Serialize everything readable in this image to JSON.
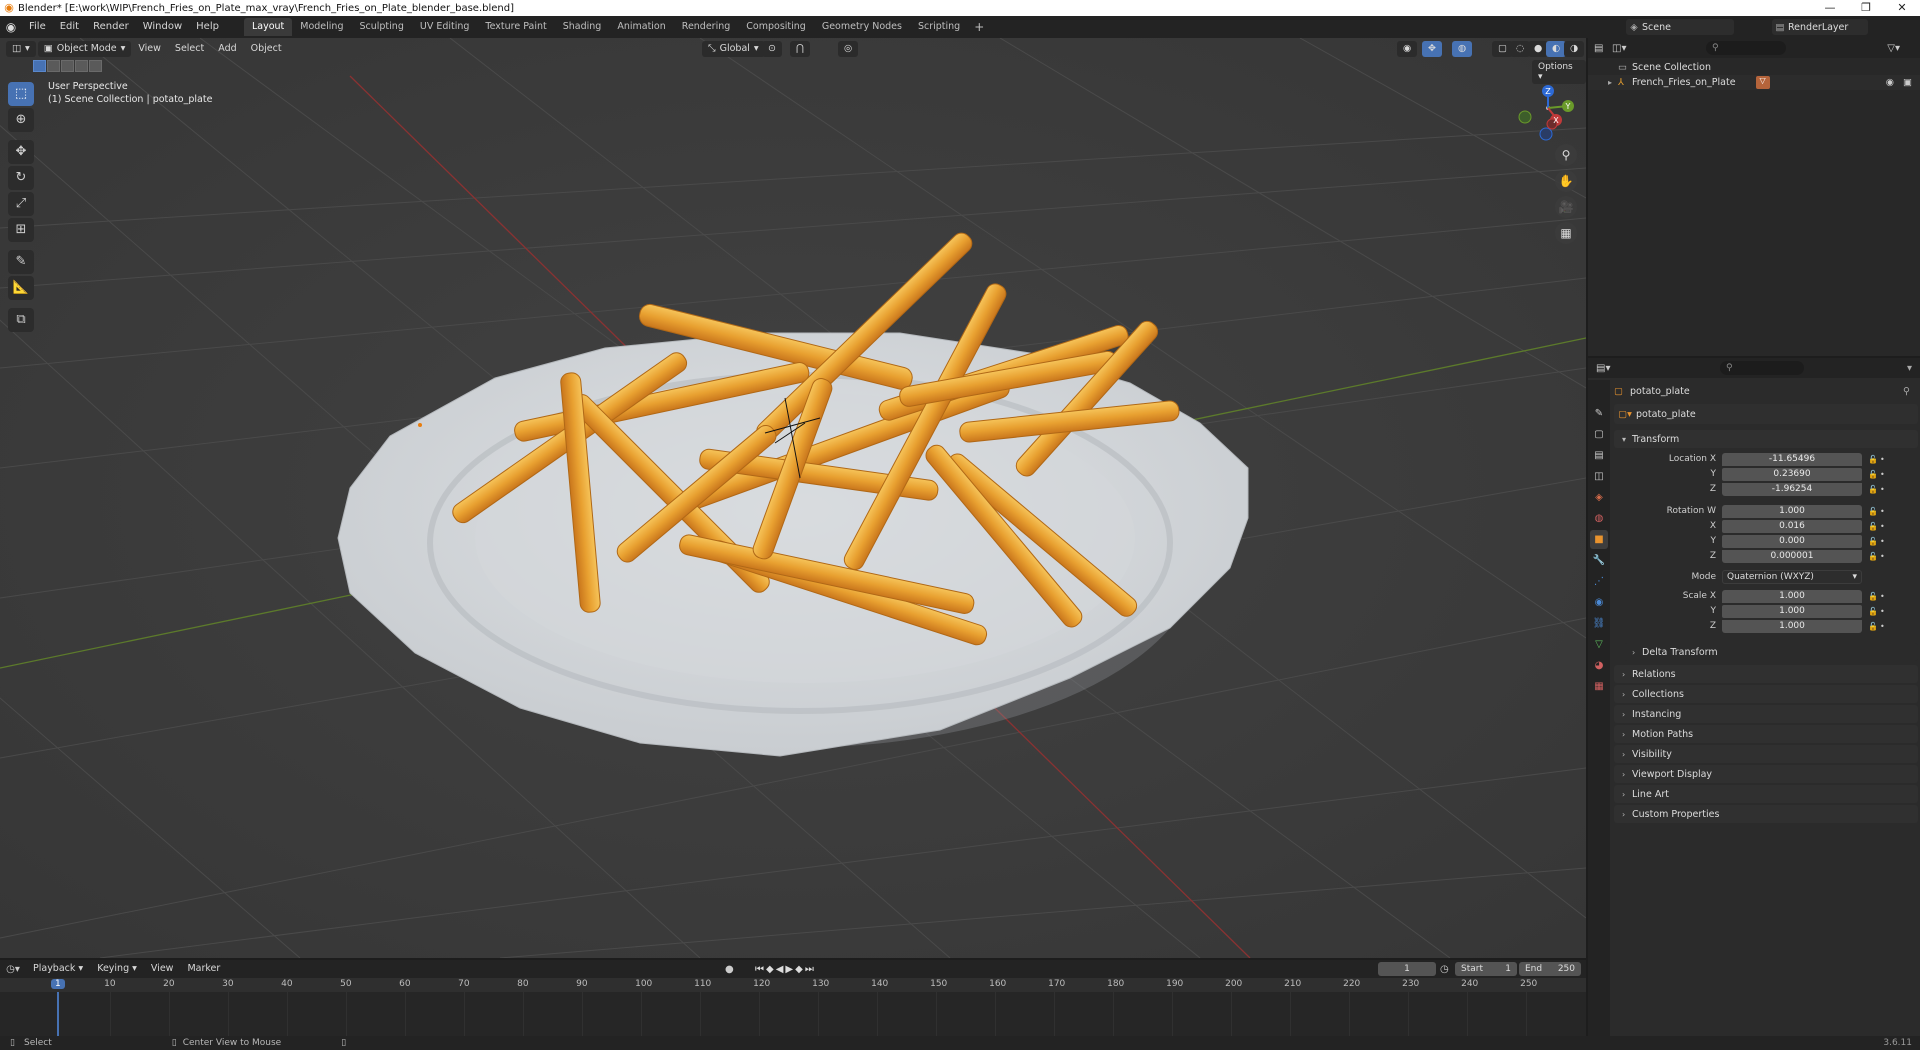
{
  "window": {
    "title": "Blender* [E:\\work\\WIP\\French_Fries_on_Plate_max_vray\\French_Fries_on_Plate_blender_base.blend]",
    "controls": [
      "minimize",
      "maximize",
      "close"
    ]
  },
  "menubar": {
    "menus": [
      "File",
      "Edit",
      "Render",
      "Window",
      "Help"
    ],
    "workspaces": [
      "Layout",
      "Modeling",
      "Sculpting",
      "UV Editing",
      "Texture Paint",
      "Shading",
      "Animation",
      "Rendering",
      "Compositing",
      "Geometry Nodes",
      "Scripting"
    ],
    "active_workspace": "Layout",
    "add_workspace": "+",
    "scene": "Scene",
    "view_layer": "RenderLayer"
  },
  "viewport": {
    "mode": "Object Mode",
    "menus": [
      "View",
      "Select",
      "Add",
      "Object"
    ],
    "orientation": "Global",
    "options_label": "Options",
    "info_line1": "User Perspective",
    "info_line2": "(1) Scene Collection | potato_plate",
    "gizmo_axes": [
      "Z",
      "Y",
      "X"
    ],
    "tools": [
      "select-box-icon",
      "cursor-icon",
      "move-icon",
      "rotate-icon",
      "scale-icon",
      "transform-icon",
      "annotate-icon",
      "measure-icon",
      "add-cube-icon"
    ]
  },
  "outliner": {
    "root": "Scene Collection",
    "items": [
      {
        "name": "French_Fries_on_Plate"
      }
    ]
  },
  "properties": {
    "object_name": "potato_plate",
    "data_name": "potato_plate",
    "transform": {
      "header": "Transform",
      "location_label": "Location X",
      "location": [
        "-11.65496",
        "0.23690",
        "-1.96254"
      ],
      "rotation_label": "Rotation W",
      "rotation": [
        "1.000",
        "0.016",
        "0.000",
        "0.000001"
      ],
      "mode_label": "Mode",
      "mode": "Quaternion (WXYZ)",
      "scale_label": "Scale X",
      "scale": [
        "1.000",
        "1.000",
        "1.000"
      ],
      "axis_labels": [
        "Y",
        "Z",
        "X"
      ]
    },
    "delta_transform": "Delta Transform",
    "panels": [
      "Relations",
      "Collections",
      "Instancing",
      "Motion Paths",
      "Visibility",
      "Viewport Display",
      "Line Art",
      "Custom Properties"
    ]
  },
  "timeline": {
    "menus": [
      "Playback",
      "Keying",
      "View",
      "Marker"
    ],
    "current_frame": "1",
    "start_label": "Start",
    "start": "1",
    "end_label": "End",
    "end": "250",
    "ruler_ticks": [
      "1",
      "10",
      "20",
      "30",
      "40",
      "50",
      "60",
      "70",
      "80",
      "90",
      "100",
      "110",
      "120",
      "130",
      "140",
      "150",
      "160",
      "170",
      "180",
      "190",
      "200",
      "210",
      "220",
      "230",
      "240",
      "250"
    ]
  },
  "statusbar": {
    "left": "Select",
    "middle": "Center View to Mouse",
    "version": "3.6.11"
  },
  "colors": {
    "accent": "#4772b3",
    "plate": "#d3d7db",
    "fries": "#e8a030",
    "x_axis": "#c23a3a",
    "y_axis": "#6a9a2a",
    "z_axis": "#2d6ad6"
  }
}
